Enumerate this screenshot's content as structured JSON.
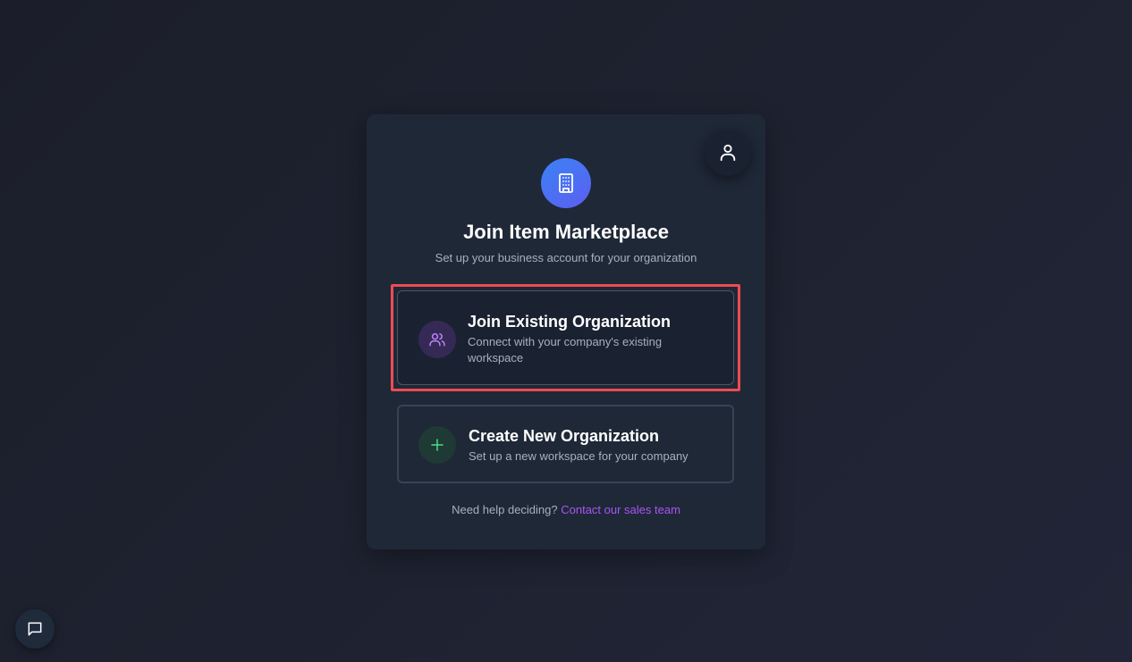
{
  "header": {
    "title": "Join Item Marketplace",
    "subtitle": "Set up your business account for your organization",
    "logo_icon": "building-icon"
  },
  "profile": {
    "icon": "user-icon"
  },
  "options": [
    {
      "title": "Join Existing Organization",
      "description": "Connect with your company's existing workspace",
      "icon": "users-icon",
      "icon_color": "#c084fc",
      "highlighted": true
    },
    {
      "title": "Create New Organization",
      "description": "Set up a new workspace for your company",
      "icon": "plus-icon",
      "icon_color": "#4ade80",
      "highlighted": false
    }
  ],
  "help": {
    "text": "Need help deciding?",
    "link_text": "Contact our sales team"
  },
  "chat": {
    "icon": "chat-bubble-icon"
  },
  "colors": {
    "accent": "#a855f7",
    "highlight_border": "#ef4b52",
    "logo_gradient_start": "#3b82f6",
    "logo_gradient_end": "#5b5ff0"
  }
}
